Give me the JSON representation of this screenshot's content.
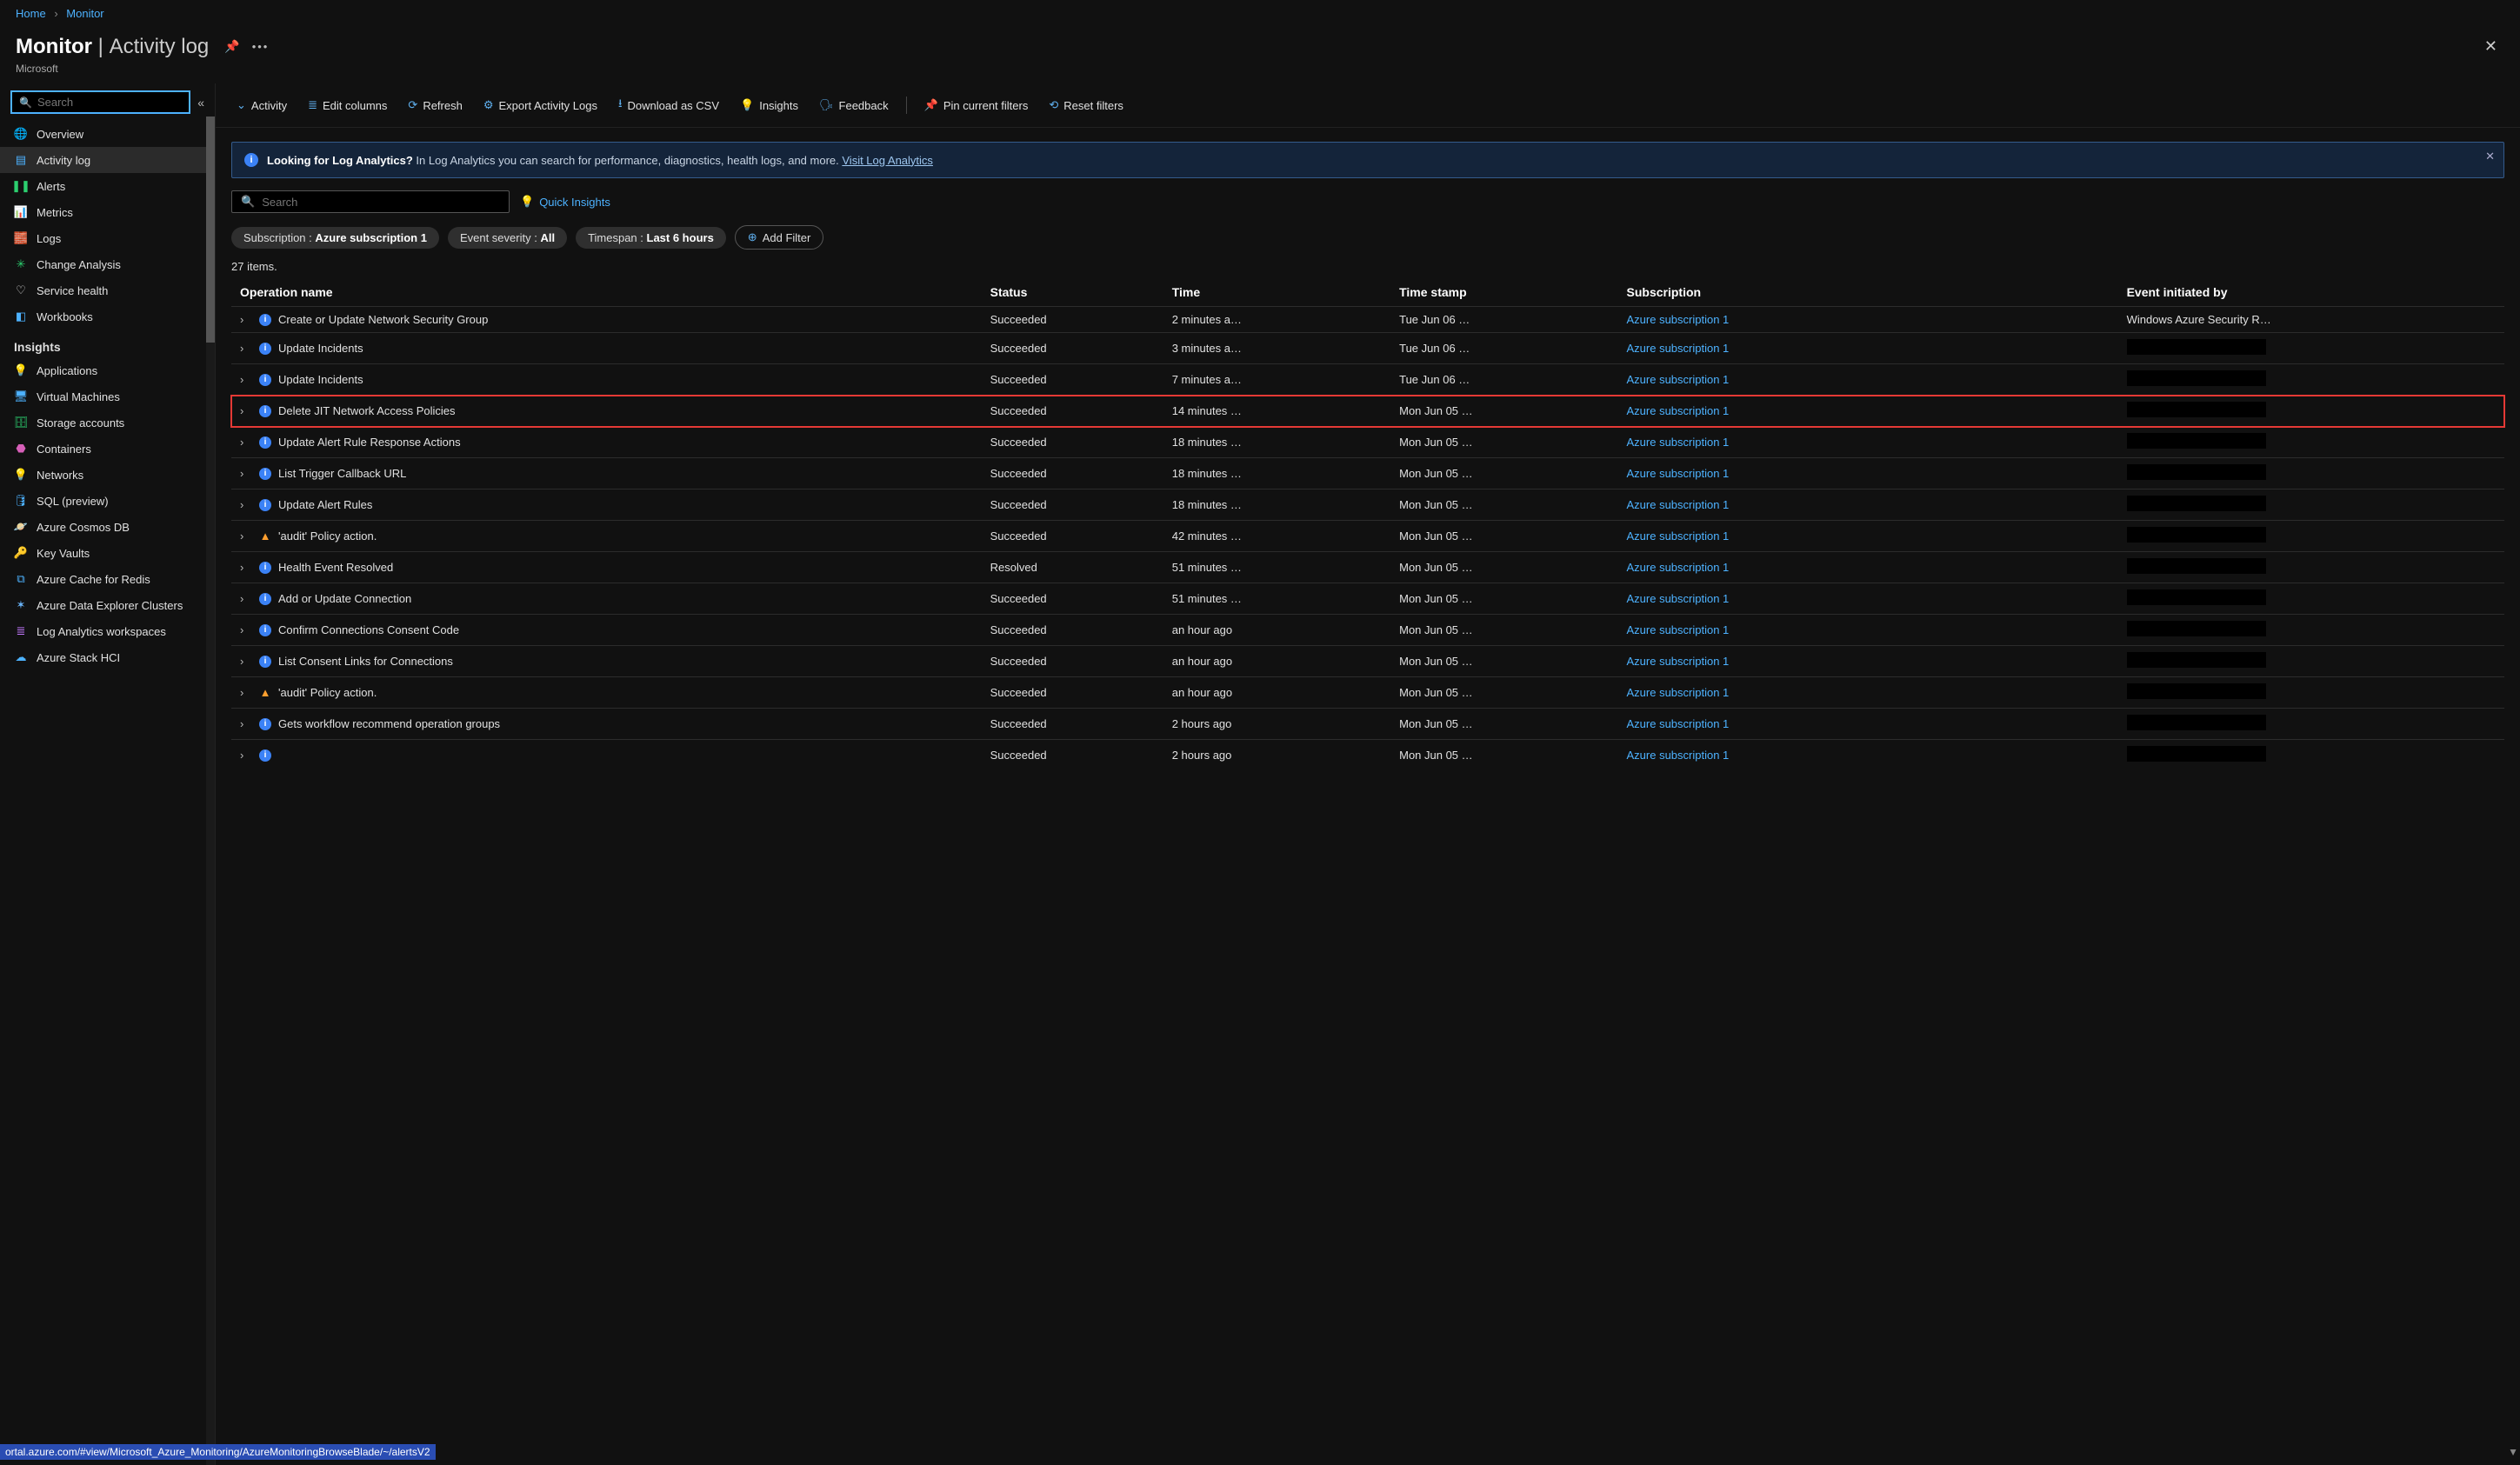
{
  "breadcrumbs": {
    "home": "Home",
    "monitor": "Monitor"
  },
  "title": {
    "main": "Monitor",
    "sub": "Activity log"
  },
  "company": "Microsoft",
  "search_placeholder": "Search",
  "sidebar": {
    "items": [
      {
        "label": "Overview",
        "icon": "🌐",
        "color": "#3b82f6"
      },
      {
        "label": "Activity log",
        "icon": "▤",
        "color": "#4db2ff",
        "active": true
      },
      {
        "label": "Alerts",
        "icon": "❚❚",
        "color": "#2ccf6f"
      },
      {
        "label": "Metrics",
        "icon": "📊",
        "color": "#e74694"
      },
      {
        "label": "Logs",
        "icon": "🧱",
        "color": "#4db2ff"
      },
      {
        "label": "Change Analysis",
        "icon": "✳",
        "color": "#2ccf6f"
      },
      {
        "label": "Service health",
        "icon": "♡",
        "color": "#ddd"
      },
      {
        "label": "Workbooks",
        "icon": "◧",
        "color": "#4db2ff"
      }
    ],
    "section_title": "Insights",
    "insights": [
      {
        "label": "Applications",
        "icon": "💡",
        "color": "#c478ff"
      },
      {
        "label": "Virtual Machines",
        "icon": "🖥",
        "color": "#4db2ff"
      },
      {
        "label": "Storage accounts",
        "icon": "🗄",
        "color": "#2ccf6f"
      },
      {
        "label": "Containers",
        "icon": "⬣",
        "color": "#d65fb8"
      },
      {
        "label": "Networks",
        "icon": "💡",
        "color": "#c478ff"
      },
      {
        "label": "SQL (preview)",
        "icon": "🛢",
        "color": "#4db2ff"
      },
      {
        "label": "Azure Cosmos DB",
        "icon": "🪐",
        "color": "#4db2ff"
      },
      {
        "label": "Key Vaults",
        "icon": "🔑",
        "color": "#f2c94c"
      },
      {
        "label": "Azure Cache for Redis",
        "icon": "⧉",
        "color": "#4db2ff"
      },
      {
        "label": "Azure Data Explorer Clusters",
        "icon": "✶",
        "color": "#6bb7ff"
      },
      {
        "label": "Log Analytics workspaces",
        "icon": "≣",
        "color": "#c478ff"
      },
      {
        "label": "Azure Stack HCI",
        "icon": "☁",
        "color": "#4db2ff"
      }
    ]
  },
  "toolbar": {
    "activity": "Activity",
    "edit": "Edit columns",
    "refresh": "Refresh",
    "export": "Export Activity Logs",
    "csv": "Download as CSV",
    "insights": "Insights",
    "feedback": "Feedback",
    "pin": "Pin current filters",
    "reset": "Reset filters"
  },
  "banner": {
    "lead": "Looking for Log Analytics?",
    "body": "In Log Analytics you can search for performance, diagnostics, health logs, and more.",
    "link": "Visit Log Analytics"
  },
  "main_search_placeholder": "Search",
  "quick_insights": "Quick Insights",
  "filters": {
    "sub_label": "Subscription : ",
    "sub_value": "Azure subscription 1",
    "sev_label": "Event severity : ",
    "sev_value": "All",
    "time_label": "Timespan : ",
    "time_value": "Last 6 hours",
    "add": "Add Filter"
  },
  "items_count": "27 items.",
  "columns": {
    "op": "Operation name",
    "status": "Status",
    "time": "Time",
    "ts": "Time stamp",
    "sub": "Subscription",
    "init": "Event initiated by"
  },
  "rows": [
    {
      "icon": "info",
      "op": "Create or Update Network Security Group",
      "status": "Succeeded",
      "time": "2 minutes a…",
      "ts": "Tue Jun 06 …",
      "sub": "Azure subscription 1",
      "init": "Windows Azure Security R…"
    },
    {
      "icon": "info",
      "op": "Update Incidents",
      "status": "Succeeded",
      "time": "3 minutes a…",
      "ts": "Tue Jun 06 …",
      "sub": "Azure subscription 1",
      "init": "__REDACT__"
    },
    {
      "icon": "info",
      "op": "Update Incidents",
      "status": "Succeeded",
      "time": "7 minutes a…",
      "ts": "Tue Jun 06 …",
      "sub": "Azure subscription 1",
      "init": "__REDACT__"
    },
    {
      "icon": "info",
      "op": "Delete JIT Network Access Policies",
      "status": "Succeeded",
      "time": "14 minutes …",
      "ts": "Mon Jun 05 …",
      "sub": "Azure subscription 1",
      "init": "__REDACT__",
      "hl": true
    },
    {
      "icon": "info",
      "op": "Update Alert Rule Response Actions",
      "status": "Succeeded",
      "time": "18 minutes …",
      "ts": "Mon Jun 05 …",
      "sub": "Azure subscription 1",
      "init": "__REDACT__"
    },
    {
      "icon": "info",
      "op": "List Trigger Callback URL",
      "status": "Succeeded",
      "time": "18 minutes …",
      "ts": "Mon Jun 05 …",
      "sub": "Azure subscription 1",
      "init": "__REDACT__"
    },
    {
      "icon": "info",
      "op": "Update Alert Rules",
      "status": "Succeeded",
      "time": "18 minutes …",
      "ts": "Mon Jun 05 …",
      "sub": "Azure subscription 1",
      "init": "__REDACT__"
    },
    {
      "icon": "warn",
      "op": "'audit' Policy action.",
      "status": "Succeeded",
      "time": "42 minutes …",
      "ts": "Mon Jun 05 …",
      "sub": "Azure subscription 1",
      "init": "__REDACT__"
    },
    {
      "icon": "info",
      "op": "Health Event Resolved",
      "status": "Resolved",
      "time": "51 minutes …",
      "ts": "Mon Jun 05 …",
      "sub": "Azure subscription 1",
      "init": "__REDACT__"
    },
    {
      "icon": "info",
      "op": "Add or Update Connection",
      "status": "Succeeded",
      "time": "51 minutes …",
      "ts": "Mon Jun 05 …",
      "sub": "Azure subscription 1",
      "init": "__REDACT__"
    },
    {
      "icon": "info",
      "op": "Confirm Connections Consent Code",
      "status": "Succeeded",
      "time": "an hour ago",
      "ts": "Mon Jun 05 …",
      "sub": "Azure subscription 1",
      "init": "__REDACT__"
    },
    {
      "icon": "info",
      "op": "List Consent Links for Connections",
      "status": "Succeeded",
      "time": "an hour ago",
      "ts": "Mon Jun 05 …",
      "sub": "Azure subscription 1",
      "init": "__REDACT__"
    },
    {
      "icon": "warn",
      "op": "'audit' Policy action.",
      "status": "Succeeded",
      "time": "an hour ago",
      "ts": "Mon Jun 05 …",
      "sub": "Azure subscription 1",
      "init": "__REDACT__"
    },
    {
      "icon": "info",
      "op": "Gets workflow recommend operation groups",
      "status": "Succeeded",
      "time": "2 hours ago",
      "ts": "Mon Jun 05 …",
      "sub": "Azure subscription 1",
      "init": "__REDACT__"
    },
    {
      "icon": "info",
      "op": "",
      "status": "Succeeded",
      "time": "2 hours ago",
      "ts": "Mon Jun 05 …",
      "sub": "Azure subscription 1",
      "init": "__REDACT__"
    }
  ],
  "statusbar": "ortal.azure.com/#view/Microsoft_Azure_Monitoring/AzureMonitoringBrowseBlade/~/alertsV2"
}
